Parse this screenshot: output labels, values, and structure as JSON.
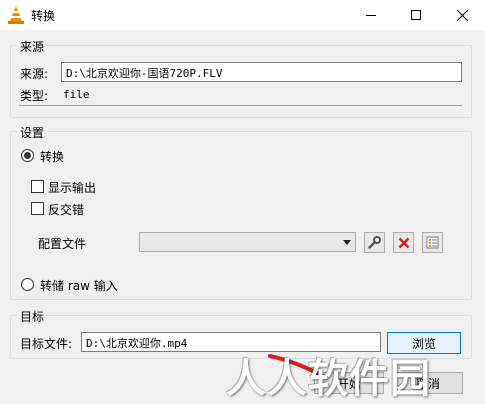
{
  "window": {
    "title": "转换",
    "controls": {
      "minimize": "minimize-icon",
      "maximize": "maximize-icon",
      "close": "close-icon"
    }
  },
  "source": {
    "group_label": "来源",
    "source_label": "来源:",
    "source_value": "D:\\北京欢迎你-国语720P.FLV",
    "type_label": "类型:",
    "type_value": "file"
  },
  "settings": {
    "group_label": "设置",
    "convert_label": "转换",
    "convert_selected": true,
    "show_output_label": "显示输出",
    "deinterlace_label": "反交错",
    "profile_label": "配置文件",
    "profile_value": "",
    "dump_raw_label": "转储 raw 输入",
    "icons": {
      "edit": "wrench-icon",
      "delete": "delete-icon",
      "new": "new-profile-icon"
    }
  },
  "target": {
    "group_label": "目标",
    "dest_file_label": "目标文件:",
    "dest_file_value": "D:\\北京欢迎你.mp4",
    "browse_label": "浏览"
  },
  "footer": {
    "start_label": "开始",
    "cancel_label": "取消"
  },
  "watermark": {
    "text": "人人软件园"
  },
  "colors": {
    "focus_border": "#0078d7",
    "delete_red": "#d32020"
  }
}
